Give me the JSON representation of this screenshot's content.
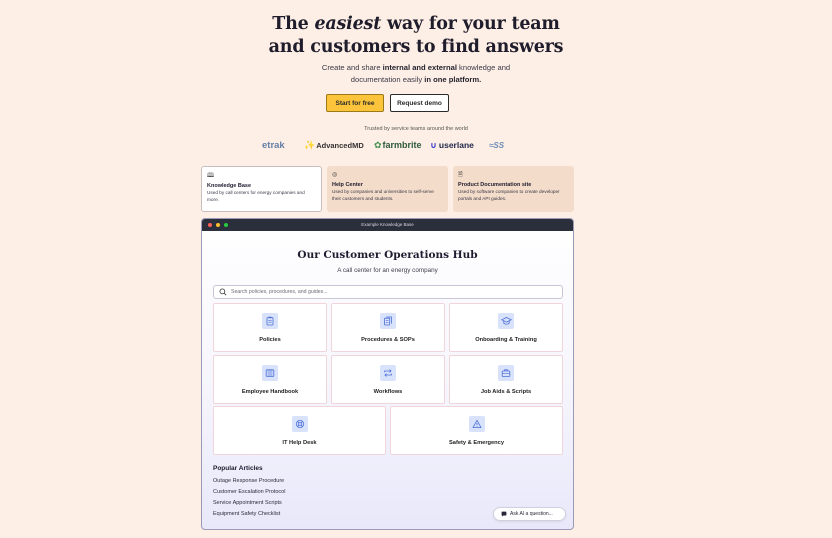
{
  "hero": {
    "title_pre": "The ",
    "title_em": "easiest",
    "title_post": " way for your team",
    "title_line2": "and customers to find answers",
    "sub_1": "Create and share ",
    "sub_b1": "internal and external",
    "sub_2": " knowledge and",
    "sub_3": "documentation easily ",
    "sub_b2": "in one platform."
  },
  "cta": {
    "primary": "Start for free",
    "secondary": "Request demo"
  },
  "trusted": "Trusted by service teams around the world",
  "logos": {
    "fadetrak": "etrak",
    "advancedmd_a": "Advanced",
    "advancedmd_b": "MD",
    "farmbrite": "farmbrite",
    "userlane": "userlane",
    "ss": "SS"
  },
  "usecases": [
    {
      "title": "Knowledge Base",
      "desc": "Used by call centers for energy companies and more."
    },
    {
      "title": "Help Center",
      "desc": "Used by companies and universities to self-serve their customers and students."
    },
    {
      "title": "Product Documentation site",
      "desc": "Used by software companies to create developer portals and API guides."
    }
  ],
  "window": {
    "titlebar": "Example Knowledge Base",
    "title": "Our Customer Operations Hub",
    "subtitle": "A call center for an energy company",
    "search_placeholder": "Search policies, procedures, and guides..."
  },
  "categories": [
    {
      "label": "Policies",
      "icon": "clipboard-icon"
    },
    {
      "label": "Procedures & SOPs",
      "icon": "documents-icon"
    },
    {
      "label": "Onboarding & Training",
      "icon": "graduation-cap-icon"
    },
    {
      "label": "Employee Handbook",
      "icon": "book-icon"
    },
    {
      "label": "Workflows",
      "icon": "arrows-loop-icon"
    },
    {
      "label": "Job Aids & Scripts",
      "icon": "briefcase-icon"
    },
    {
      "label": "IT Help Desk",
      "icon": "lifebuoy-icon"
    },
    {
      "label": "Safety & Emergency",
      "icon": "warning-icon"
    }
  ],
  "popular": {
    "title": "Popular Articles",
    "articles": [
      "Outage Response Procedure",
      "Customer Escalation Protocol",
      "Service Appointment Scripts",
      "Equipment Safety Checklist"
    ]
  },
  "ask_ai": "Ask AI a question...",
  "colors": {
    "background": "#fdefe5",
    "primary_button": "#fbc43a",
    "icon_tile": "#d9e2fb",
    "icon_stroke": "#4a6fd6",
    "window_bar": "#2b2f3b"
  }
}
